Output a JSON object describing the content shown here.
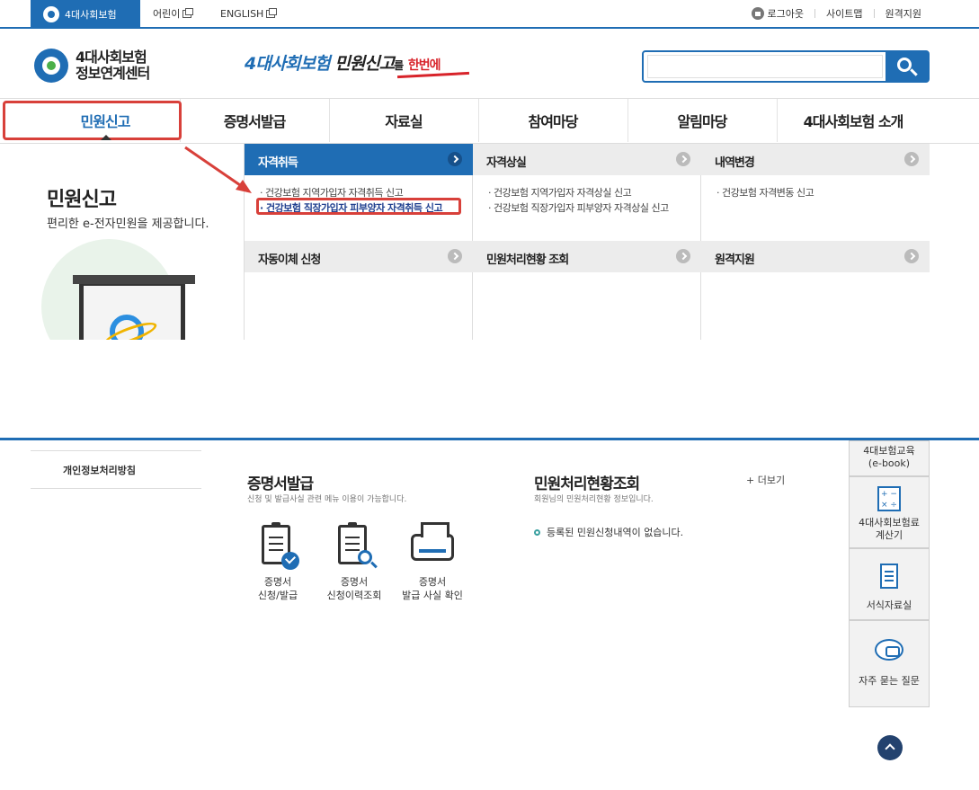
{
  "topbar": {
    "home_label": "4대사회보험",
    "kids_label": "어린이",
    "english_label": "ENGLISH",
    "logout_label": "로그아웃",
    "sitemap_label": "사이트맵",
    "remote_label": "원격지원"
  },
  "header": {
    "logo_line1": "4대사회보험",
    "logo_line2": "정보연계센터",
    "slogan_part1": "4대사회보험",
    "slogan_part2": "민원신고",
    "slogan_part3": "를",
    "slogan_part4": "한번에",
    "search_value": "",
    "search_placeholder": ""
  },
  "gnb": {
    "items": [
      {
        "label": "민원신고"
      },
      {
        "label": "증명서발급"
      },
      {
        "label": "자료실"
      },
      {
        "label": "참여마당"
      },
      {
        "label": "알림마당"
      },
      {
        "label": "4대사회보험 소개"
      }
    ]
  },
  "dropdown": {
    "title": "민원신고",
    "description": "편리한 e-전자민원을 제공합니다.",
    "cats": [
      {
        "label": "자격취득",
        "subs": [
          "· 건강보험 지역가입자 자격취득 신고",
          "· 건강보험 직장가입자 피부양자 자격취득 신고"
        ]
      },
      {
        "label": "자격상실",
        "subs": [
          "· 건강보험 지역가입자 자격상실 신고",
          "· 건강보험 직장가입자 피부양자 자격상실 신고"
        ]
      },
      {
        "label": "내역변경",
        "subs": [
          "· 건강보험 자격변동 신고"
        ]
      },
      {
        "label": "자동이체 신청",
        "subs": []
      },
      {
        "label": "민원처리현황 조회",
        "subs": []
      },
      {
        "label": "원격지원",
        "subs": []
      }
    ]
  },
  "footer": {
    "privacy_label": "개인정보처리방침",
    "cert": {
      "title": "증명서발급",
      "subtitle": "신청 및 발급사실 관련 메뉴 이용이 가능합니다.",
      "services": [
        {
          "line1": "증명서",
          "line2": "신청/발급"
        },
        {
          "line1": "증명서",
          "line2": "신청이력조회"
        },
        {
          "line1": "증명서",
          "line2": "발급 사실 확인"
        }
      ]
    },
    "status": {
      "title": "민원처리현황조회",
      "subtitle": "회원님의 민원처리현황 정보입니다.",
      "more_label": "+ 더보기",
      "empty_message": "등록된 민원신청내역이 없습니다."
    }
  },
  "quick_menu": [
    {
      "line1": "4대보험교육",
      "line2": "(e-book)",
      "icon": "book-icon"
    },
    {
      "line1": "4대사회보험료",
      "line2": "계산기",
      "icon": "calculator-icon"
    },
    {
      "line1": "서식자료실",
      "line2": "",
      "icon": "document-icon"
    },
    {
      "line1": "자주 묻는 질문",
      "line2": "",
      "icon": "chat-bubble-icon"
    }
  ],
  "colors": {
    "brand_blue": "#1f6db4",
    "highlight_red": "#d8403a",
    "accent_red": "#d8232a"
  }
}
